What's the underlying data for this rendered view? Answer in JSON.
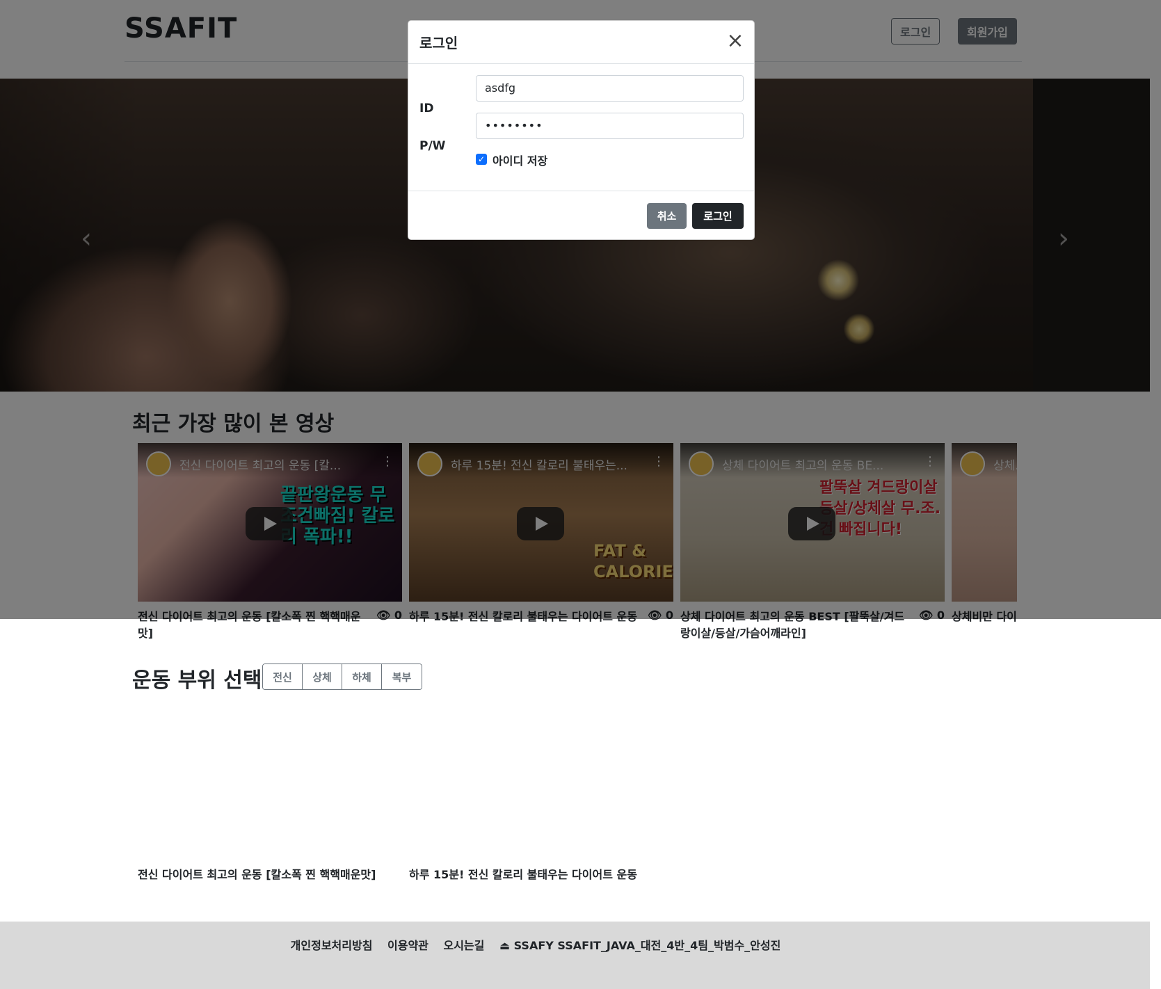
{
  "header": {
    "logo": "SSAFIT",
    "login_label": "로그인",
    "signup_label": "회원가입"
  },
  "carousel": {
    "prev_icon": "chevron-left-icon",
    "next_icon": "chevron-right-icon"
  },
  "popular": {
    "title": "최근 가장 많이 본 영상",
    "videos": [
      {
        "thumb_title": "전신 다이어트 최고의 운동 [칼...",
        "thumb_text": "끝판왕운동 무조건빠짐! 칼로리 폭파!!",
        "caption": "전신 다이어트 최고의 운동 [칼소폭 찐 핵핵매운맛]",
        "views": "0"
      },
      {
        "thumb_title": "하루 15분! 전신 칼로리 불태우는...",
        "thumb_text": "FAT & CALORIE",
        "caption": "하루 15분! 전신 칼로리 불태우는 다이어트 운동",
        "views": "0"
      },
      {
        "thumb_title": "상체 다이어트 최고의 운동 BE...",
        "thumb_text": "팔뚝살 겨드랑이살 등살/상체살 무.조.건 빠집니다!",
        "caption": "상체 다이어트 최고의 운동 BEST [팔뚝살/겨드랑이살/등살/가슴어깨라인]",
        "views": "0"
      },
      {
        "thumb_title": "상체...",
        "thumb_text": "",
        "caption": "상체비만 다이어트 운동 매운맛]",
        "views": ""
      }
    ]
  },
  "parts": {
    "title": "운동 부위 선택",
    "options": [
      "전신",
      "상체",
      "하체",
      "복부"
    ]
  },
  "part_videos": [
    {
      "caption": "전신 다이어트 최고의 운동 [칼소폭 찐 핵핵매운맛]"
    },
    {
      "caption": "하루 15분! 전신 칼로리 불태우는 다이어트 운동"
    }
  ],
  "footer": {
    "links": [
      "개인정보처리방침",
      "이용약관",
      "오시는길"
    ],
    "credit": "⏏ SSAFY SSAFIT_JAVA_대전_4반_4팀_박범수_안성진"
  },
  "modal": {
    "title": "로그인",
    "id_label": "ID",
    "id_value": "asdfg",
    "pw_label": "P/W",
    "pw_value": "••••••••",
    "remember_label": "아이디 저장",
    "remember_checked": true,
    "cancel_label": "취소",
    "submit_label": "로그인"
  },
  "colors": {
    "primary": "#0d6efd",
    "secondary": "#6c757d",
    "dark": "#212529"
  }
}
